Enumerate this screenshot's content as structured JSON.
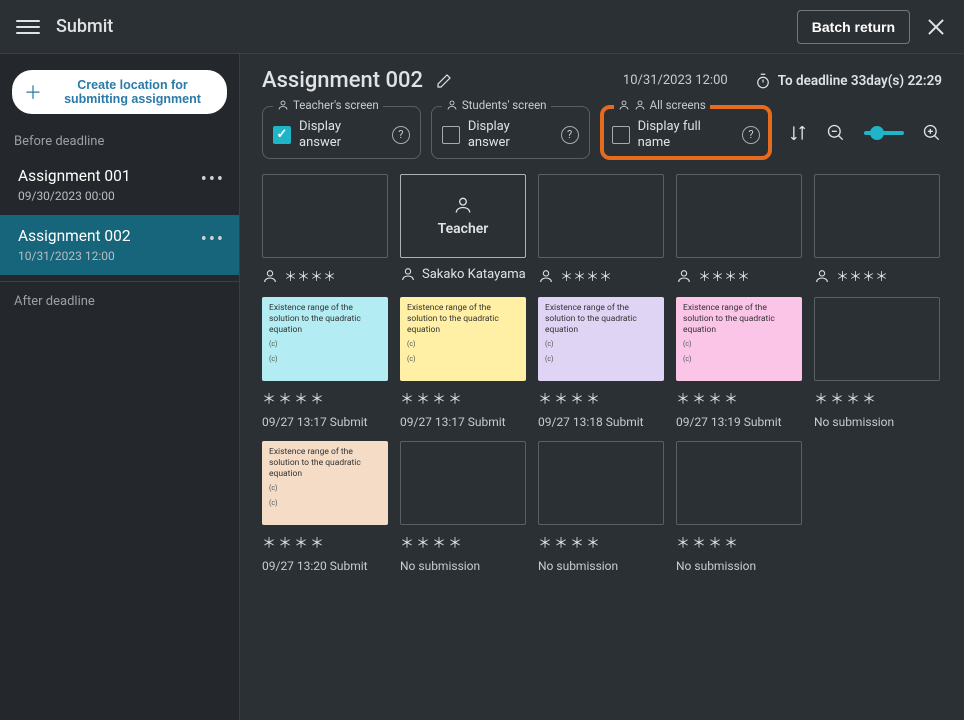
{
  "topbar": {
    "title": "Submit",
    "batch_return": "Batch return"
  },
  "sidebar": {
    "create_label": "Create location for submitting assignment",
    "before_label": "Before deadline",
    "after_label": "After deadline",
    "items": [
      {
        "name": "Assignment 001",
        "date": "09/30/2023 00:00"
      },
      {
        "name": "Assignment 002",
        "date": "10/31/2023 12:00"
      }
    ]
  },
  "header": {
    "title": "Assignment 002",
    "due": "10/31/2023 12:00",
    "deadline": "To deadline 33day(s) 22:29"
  },
  "options": {
    "teacher_legend": "Teacher's screen",
    "teacher_label": "Display answer",
    "students_legend": "Students' screen",
    "students_label": "Display answer",
    "all_legend": "All screens",
    "all_label": "Display full name"
  },
  "row1": {
    "teacher_label": "Teacher",
    "teacher_name": "Sakako Katayama",
    "masked": "＊＊＊＊"
  },
  "note_text": {
    "title": "Existence range of the solution to the quadratic equation",
    "small": "(c)"
  },
  "row2": [
    {
      "color": "note-cyan",
      "stars": "＊＊＊＊",
      "sub": "09/27 13:17 Submit"
    },
    {
      "color": "note-yellow",
      "stars": "＊＊＊＊",
      "sub": "09/27 13:17 Submit"
    },
    {
      "color": "note-purple",
      "stars": "＊＊＊＊",
      "sub": "09/27 13:18 Submit"
    },
    {
      "color": "note-pink",
      "stars": "＊＊＊＊",
      "sub": "09/27 13:19 Submit"
    },
    {
      "empty": true,
      "stars": "＊＊＊＊",
      "sub": "No submission"
    }
  ],
  "row3": [
    {
      "color": "note-peach",
      "stars": "＊＊＊＊",
      "sub": "09/27 13:20 Submit"
    },
    {
      "empty": true,
      "stars": "＊＊＊＊",
      "sub": "No submission"
    },
    {
      "empty": true,
      "stars": "＊＊＊＊",
      "sub": "No submission"
    },
    {
      "empty": true,
      "stars": "＊＊＊＊",
      "sub": "No submission"
    }
  ]
}
